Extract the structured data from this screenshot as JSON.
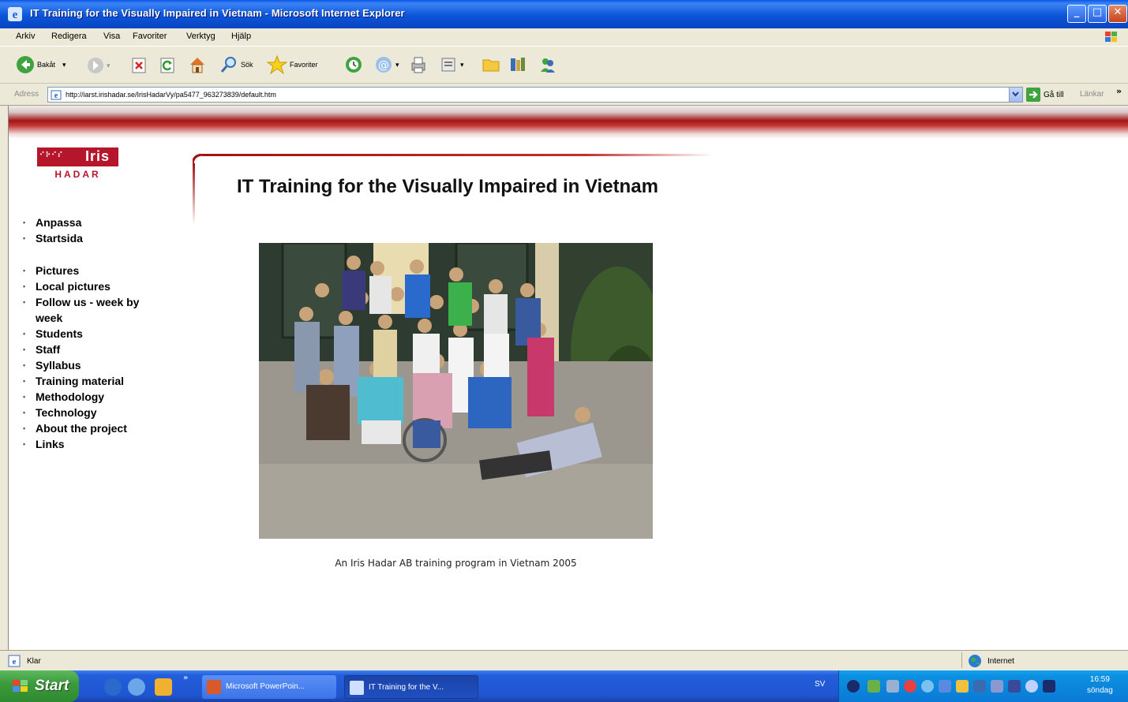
{
  "window": {
    "title": "IT Training for the Visually Impaired in Vietnam - Microsoft Internet Explorer",
    "min_glyph": "_",
    "max_glyph": "□",
    "close_glyph": "✕"
  },
  "menu": [
    "Arkiv",
    "Redigera",
    "Visa",
    "Favoriter",
    "Verktyg",
    "Hjälp"
  ],
  "toolbar": {
    "back_label": "Bakåt",
    "search_label": "Sök",
    "favorites_label": "Favoriter"
  },
  "address": {
    "label": "Adress",
    "url": "http://iarst.irishadar.se/IrisHadarVy/pa5477_963273839/default.htm",
    "go_label": "Gå till",
    "links_label": "Länkar",
    "more_glyph": "»"
  },
  "page": {
    "logo_word": "Iris",
    "logo_dots": "⠊⠗⠊⠎",
    "logo_sub": "HADAR",
    "heading": "IT Training for the Visually Impaired in Vietnam",
    "caption": "An Iris Hadar AB training program in Vietnam 2005",
    "nav_groups": [
      [
        "Anpassa",
        "Startsida"
      ],
      [
        "Pictures",
        "Local pictures",
        "Follow us - week by week",
        "Students",
        "Staff",
        "Syllabus",
        "Training material",
        "Methodology",
        "Technology",
        "About the project",
        "Links"
      ]
    ]
  },
  "status": {
    "left_text": "Klar",
    "zone_text": "Internet"
  },
  "taskbar": {
    "start_label": "Start",
    "tasks": [
      "Microsoft PowerPoin...",
      "IT Training for the V..."
    ],
    "language": "SV",
    "time": "16:59",
    "day": "söndag"
  }
}
